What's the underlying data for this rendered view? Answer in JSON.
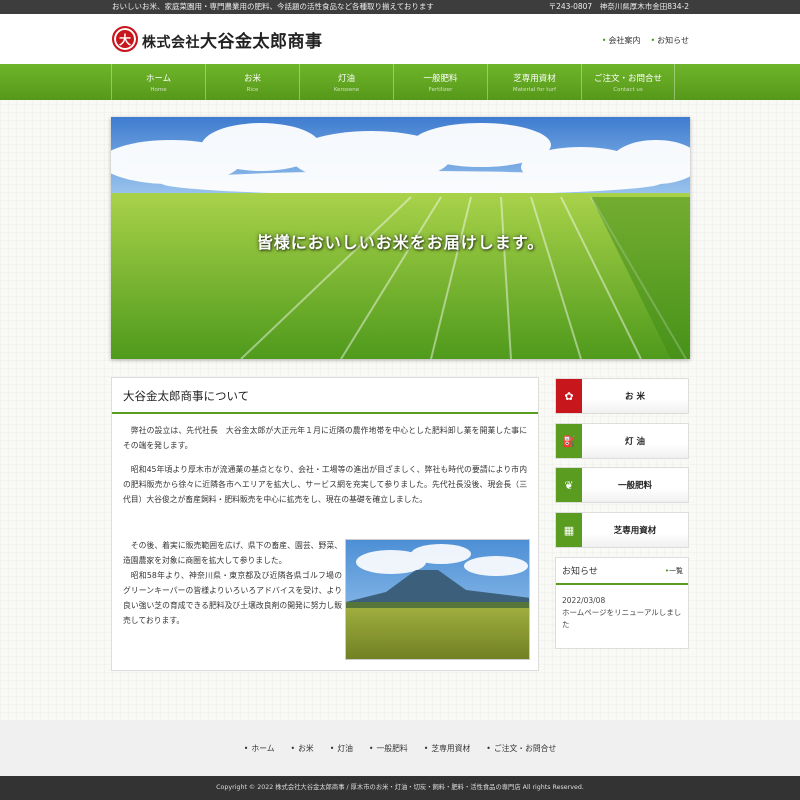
{
  "topbar": {
    "tagline": "おいしいお米、家庭菜園用・専門農業用の肥料、今話題の活性食品など各種取り揃えております",
    "address": "〒243-0807　神奈川県厚木市金田834-2"
  },
  "header": {
    "logo_mark": "大",
    "logo_prefix": "株式会社",
    "logo_name": "大谷金太郎商事",
    "links": [
      "会社案内",
      "お知らせ"
    ]
  },
  "nav": [
    {
      "label": "ホーム",
      "en": "Home"
    },
    {
      "label": "お米",
      "en": "Rice"
    },
    {
      "label": "灯油",
      "en": "Kerosene"
    },
    {
      "label": "一般肥料",
      "en": "Fertilizer"
    },
    {
      "label": "芝専用資材",
      "en": "Material for turf"
    },
    {
      "label": "ご注文・お問合せ",
      "en": "Contact us"
    }
  ],
  "hero": {
    "caption": "皆様においしいお米をお届けします。"
  },
  "about": {
    "title": "大谷金太郎商事について",
    "p1": "弊社の設立は、先代社長　大谷金太郎が大正元年１月に近隣の農作地帯を中心とした肥料卸し業を開業した事にその端を発します。",
    "p2": "昭和45年頃より厚木市が流通業の基点となり、会社・工場等の進出が目ざましく、弊社も時代の要請により市内の肥料販売から徐々に近隣各市へエリアを拡大し、サービス網を充実して参りました。先代社長没後、現会長（三代目）大谷俊之が畜産飼料・肥料販売を中心に拡売をし、現在の基礎を確立しました。",
    "p3": "その後、着実に販売範囲を広げ、県下の畜産、園芸、野菜、造園農家を対象に商圏を拡大して参りました。",
    "p4": "昭和58年より、神奈川県・東京都及び近隣各県ゴルフ場のグリーンキーパーの皆様よりいろいろアドバイスを受け、より良い強い芝の育成できる肥料及び土壌改良剤の開発に努力し販売しております。"
  },
  "side": [
    {
      "label": "お 米",
      "icon": "rice-icon",
      "glyph": "✿",
      "color": "#c8161d"
    },
    {
      "label": "灯 油",
      "icon": "kerosene-can-icon",
      "glyph": "⛽",
      "color": "#5a9c20"
    },
    {
      "label": "一般肥料",
      "icon": "fertilizer-icon",
      "glyph": "❦",
      "color": "#5a9c20"
    },
    {
      "label": "芝専用資材",
      "icon": "turf-icon",
      "glyph": "▦",
      "color": "#5a9c20"
    }
  ],
  "news": {
    "title": "お知らせ",
    "more": "一覧",
    "date": "2022/03/08",
    "text": "ホームページをリニューアルしました"
  },
  "footer": {
    "links": [
      "ホーム",
      "お米",
      "灯油",
      "一般肥料",
      "芝専用資材",
      "ご注文・お問合せ"
    ],
    "copyright": "Copyright © 2022 株式会社大谷金太郎商事 / 厚木市のお米・灯油・切炭・飼料・肥料・活性食品の専門店 All rights Reserved."
  },
  "colors": {
    "accent_green": "#5a9c20",
    "brand_red": "#c8161d",
    "dark": "#333333"
  }
}
